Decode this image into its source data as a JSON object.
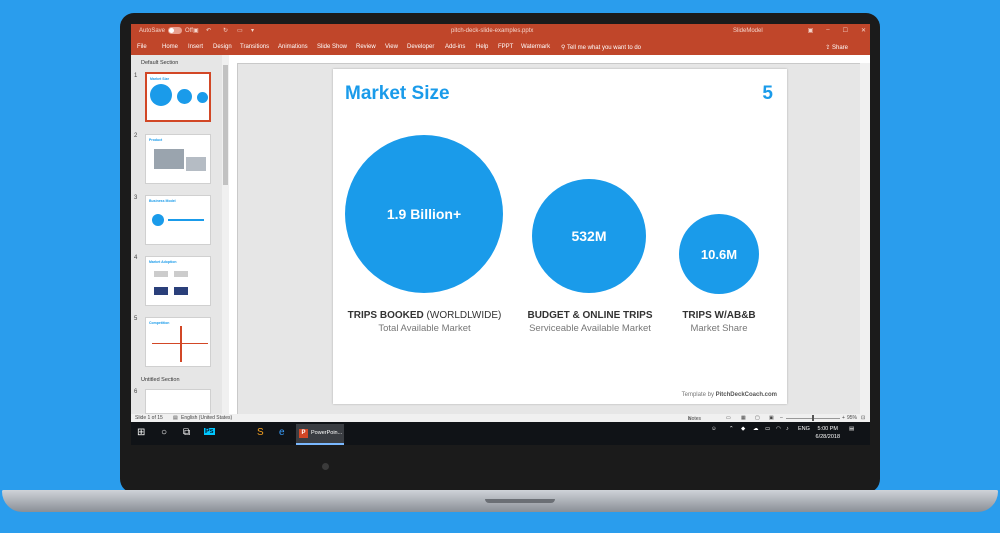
{
  "titlebar": {
    "autosave_label": "AutoSave",
    "autosave_state": "Off",
    "document_title": "pitch-deck-slide-examples.pptx",
    "brand": "SlideModel"
  },
  "ribbon": {
    "tabs": [
      "File",
      "Home",
      "Insert",
      "Design",
      "Transitions",
      "Animations",
      "Slide Show",
      "Review",
      "View",
      "Developer",
      "Add-ins",
      "Help",
      "FPPT",
      "Watermark"
    ],
    "tell_me": "Tell me what you want to do",
    "share": "Share"
  },
  "sidebar": {
    "section1": "Default Section",
    "section2": "Untitled Section",
    "slides": [
      {
        "num": "1",
        "title": "Market Size"
      },
      {
        "num": "2",
        "title": "Product"
      },
      {
        "num": "3",
        "title": "Business Model"
      },
      {
        "num": "4",
        "title": "Market Adoption"
      },
      {
        "num": "5",
        "title": "Competition"
      },
      {
        "num": "6",
        "title": ""
      }
    ]
  },
  "slide": {
    "title": "Market Size",
    "number": "5",
    "circles": [
      {
        "value": "1.9 Billion+",
        "head_bold": "TRIPS BOOKED",
        "head_regular": " (WORLDLWIDE)",
        "sub": "Total Available Market"
      },
      {
        "value": "532M",
        "head_bold": "BUDGET & ONLINE TRIPS",
        "head_regular": "",
        "sub": "Serviceable Available Market"
      },
      {
        "value": "10.6M",
        "head_bold": "TRIPS W/AB&B",
        "head_regular": "",
        "sub": "Market Share"
      }
    ],
    "credit_prefix": "Template by ",
    "credit_brand": "PitchDeckCoach.com"
  },
  "statusbar": {
    "slide_of": "Slide 1 of 15",
    "language": "English (United States)",
    "notes": "Notes",
    "zoom": "95%"
  },
  "taskbar": {
    "app_label": "PowerPoin...",
    "language": "ENG",
    "time": "5:00 PM",
    "date": "6/28/2018"
  },
  "colors": {
    "accent": "#1a9bea",
    "ribbon": "#c0462a",
    "background": "#2a9ded"
  }
}
